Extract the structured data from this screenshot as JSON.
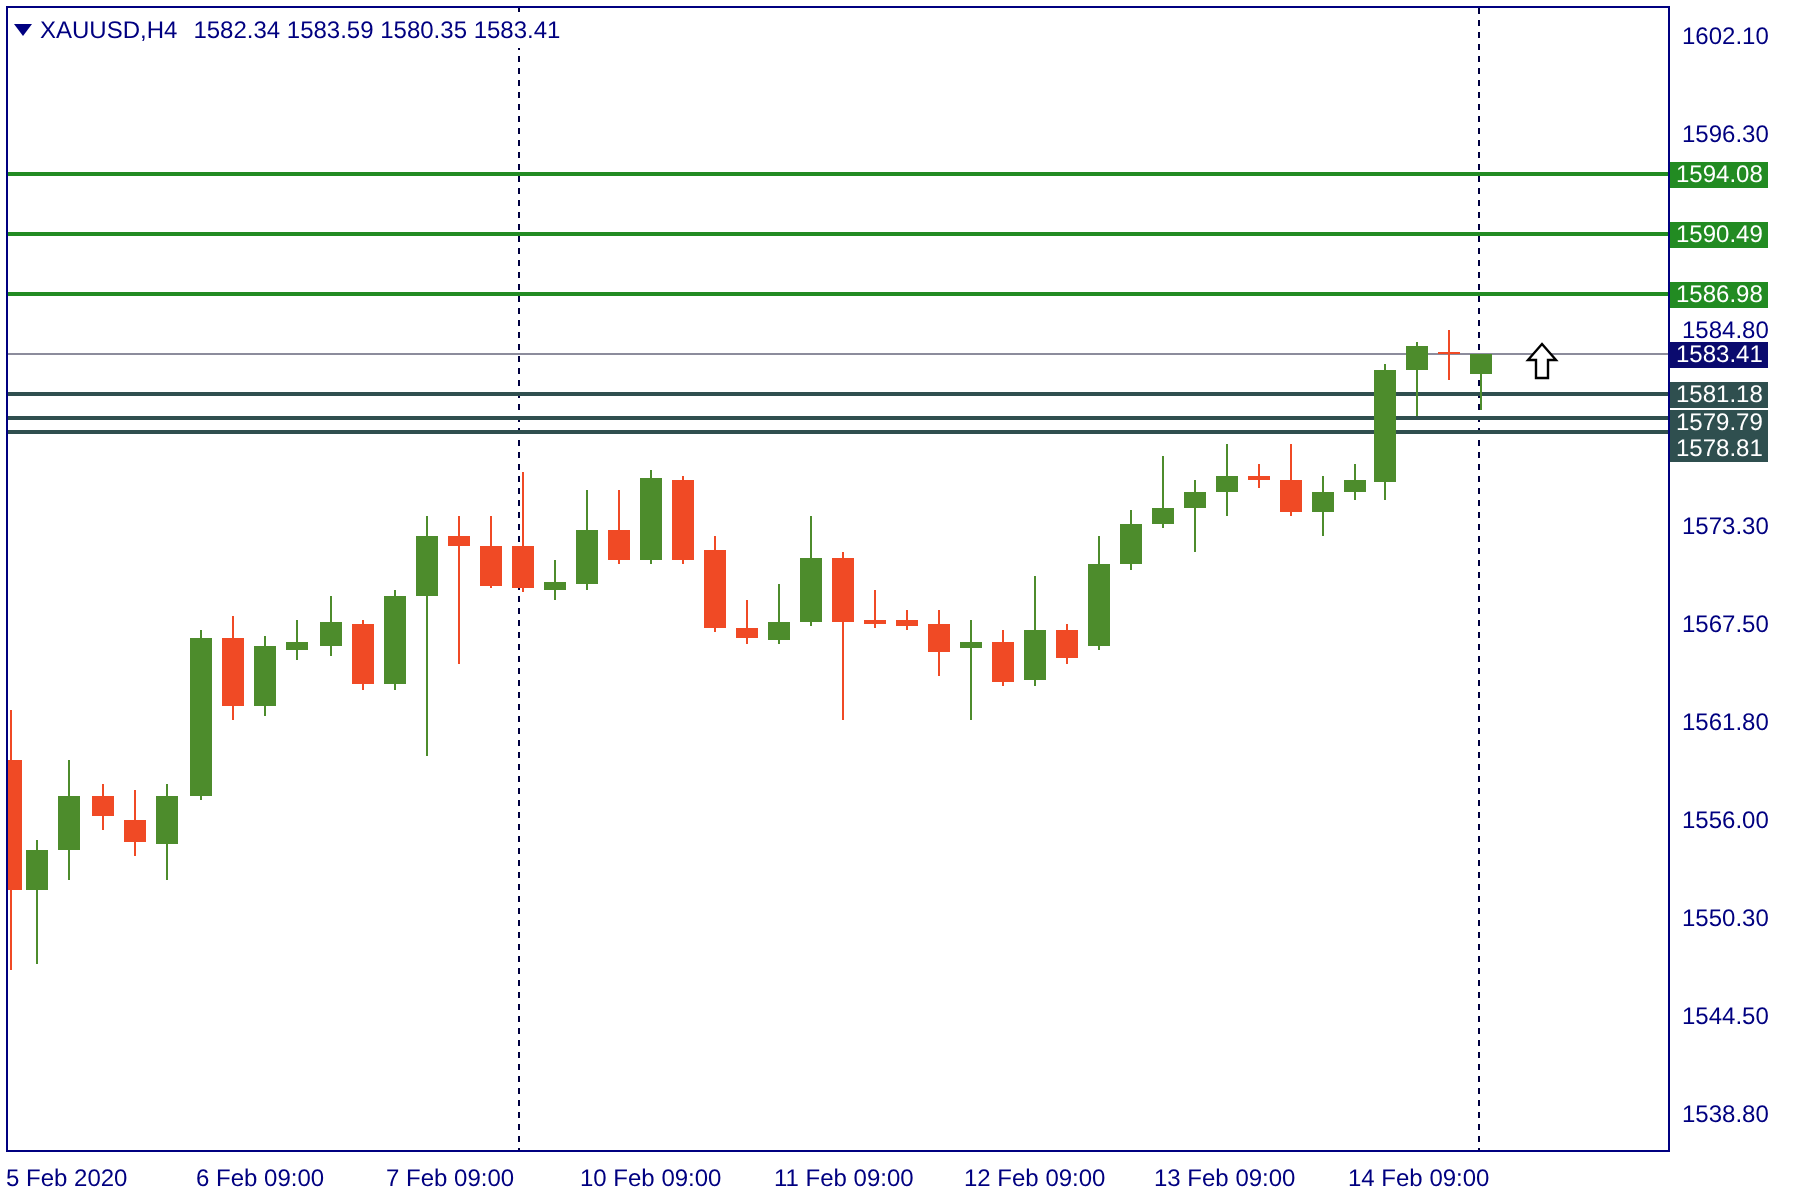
{
  "title": {
    "symbol": "XAUUSD,H4",
    "ohlc": "1582.34 1583.59 1580.35 1583.41"
  },
  "price_axis": {
    "ticks": [
      "1602.10",
      "1596.30",
      "1584.80",
      "1573.30",
      "1567.50",
      "1561.80",
      "1556.00",
      "1550.30",
      "1544.50",
      "1538.80"
    ]
  },
  "levels": [
    {
      "kind": "resistance",
      "label": "1594.08"
    },
    {
      "kind": "resistance",
      "label": "1590.49"
    },
    {
      "kind": "resistance",
      "label": "1586.98"
    },
    {
      "kind": "current",
      "label": "1583.41"
    },
    {
      "kind": "support",
      "label": "1581.18"
    },
    {
      "kind": "support",
      "label": "1579.79"
    },
    {
      "kind": "support",
      "label": "1578.81"
    }
  ],
  "time_axis": {
    "labels": [
      "5 Feb 2020",
      "6 Feb 09:00",
      "7 Feb 09:00",
      "10 Feb 09:00",
      "11 Feb 09:00",
      "12 Feb 09:00",
      "13 Feb 09:00",
      "14 Feb 09:00"
    ]
  }
}
